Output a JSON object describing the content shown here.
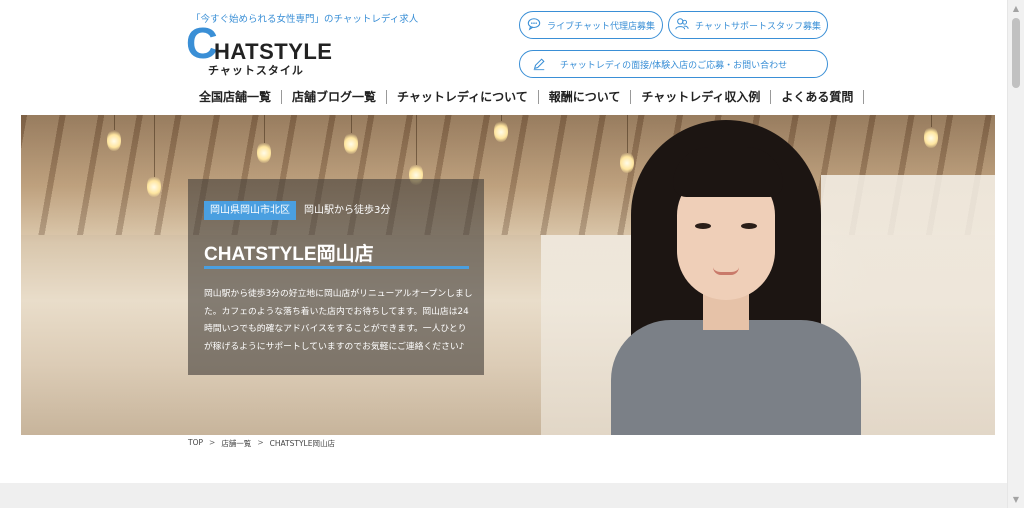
{
  "header": {
    "tagline": "「今すぐ始められる女性専門」のチャットレディ求人",
    "logo": {
      "initial": "C",
      "word": "HATSTYLE",
      "kana": "チャットスタイル"
    },
    "buttons": {
      "agency_label": "ライブチャット代理店募集",
      "support_label": "チャットサポートスタッフ募集",
      "interview_label": "チャットレディの面接/体験入店のご応募・お問い合わせ"
    }
  },
  "nav": {
    "items": [
      {
        "label": "全国店舗一覧"
      },
      {
        "label": "店舗ブログ一覧"
      },
      {
        "label": "チャットレディについて"
      },
      {
        "label": "報酬について"
      },
      {
        "label": "チャットレディ収入例"
      },
      {
        "label": "よくある質問"
      }
    ]
  },
  "hero": {
    "area": "岡山県岡山市北区",
    "access": "岡山駅から徒歩3分",
    "shop_name": "CHATSTYLE岡山店",
    "description": "岡山駅から徒歩3分の好立地に岡山店がリニューアルオープンしました。カフェのような落ち着いた店内でお待ちしてます。岡山店は24時間いつでも的確なアドバイスをすることができます。一人ひとりが稼げるようにサポートしていますのでお気軽にご連絡ください♪"
  },
  "breadcrumb": {
    "items": [
      "TOP",
      "店舗一覧",
      "CHATSTYLE岡山店"
    ],
    "separator": ">"
  },
  "colors": {
    "accent": "#3a8fd6",
    "badge": "#4a9fe0"
  },
  "icons": {
    "agency": "chat-bubble-icon",
    "support": "people-icon",
    "interview": "pencil-icon"
  }
}
